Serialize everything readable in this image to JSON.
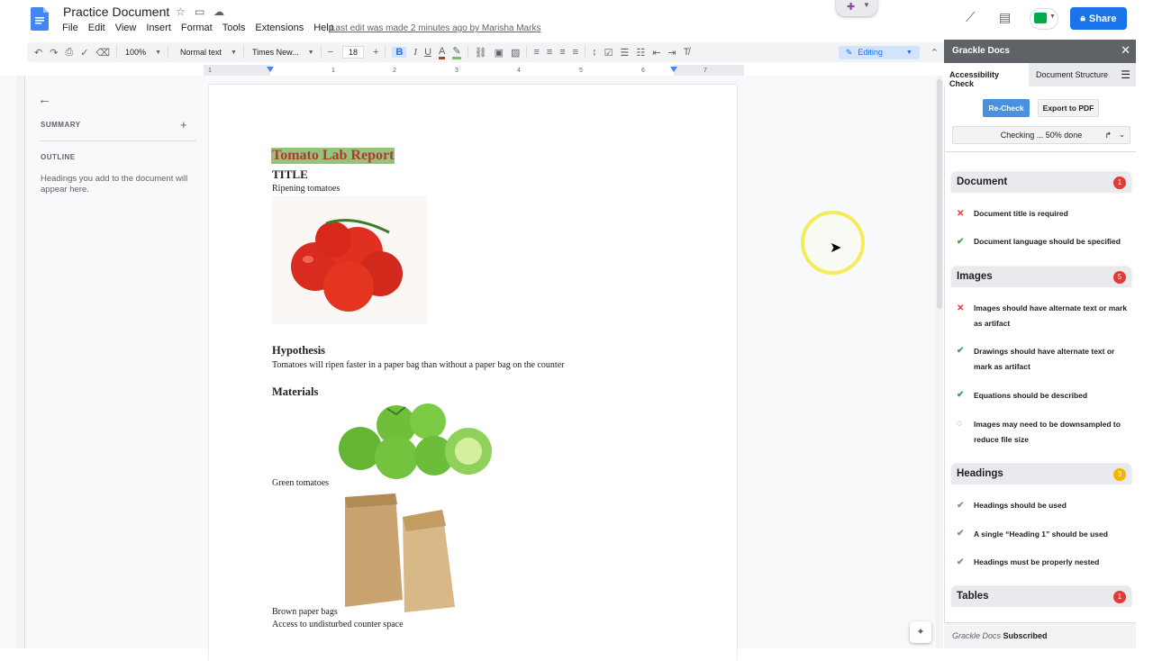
{
  "title": "Practice Document",
  "menu": [
    "File",
    "Edit",
    "View",
    "Insert",
    "Format",
    "Tools",
    "Extensions",
    "Help"
  ],
  "last_edit": "Last edit was made 2 minutes ago by Marisha Marks",
  "share_label": "Share",
  "toolbar": {
    "zoom": "100%",
    "style": "Normal text",
    "font": "Times New...",
    "font_size": "18",
    "mode": "Editing",
    "bold": "B",
    "italic": "I",
    "underline": "U",
    "text_color": "A"
  },
  "ruler_marks": [
    "1",
    "1",
    "2",
    "3",
    "4",
    "5",
    "6",
    "7"
  ],
  "outline": {
    "summary": "SUMMARY",
    "outline": "OUTLINE",
    "hint": "Headings you add to the document will appear here."
  },
  "doc": {
    "heading": "Tomato Lab Report",
    "title": "TITLE",
    "subtitle": "Ripening tomatoes",
    "hypothesis_h": "Hypothesis",
    "hypothesis": "Tomatoes will ripen faster in a paper bag than without a paper bag on the counter",
    "materials_h": "Materials",
    "m1": "Green tomatoes",
    "m2": "Brown paper bags",
    "m3": "Access to undisturbed counter space"
  },
  "sidebar": {
    "header": "Grackle Docs",
    "tab1": "Accessibility Check",
    "tab2": "Document Structure",
    "recheck": "Re-Check",
    "export": "Export to PDF",
    "status": "Checking ... 50% done",
    "footer_brand": "Grackle Docs",
    "footer_status": "Subscribed",
    "sections": [
      {
        "name": "Document",
        "count": "1",
        "color": "#e53935"
      },
      {
        "name": "Images",
        "count": "5",
        "color": "#e53935"
      },
      {
        "name": "Headings",
        "count": "3",
        "color": "#f4b400"
      },
      {
        "name": "Tables",
        "count": "1",
        "color": "#e53935"
      }
    ],
    "checks": {
      "doc1": "Document title is required",
      "doc2": "Document language should be specified",
      "img1": "Images should have alternate text or mark as artifact",
      "img2": "Drawings should have alternate text or mark as artifact",
      "img3": "Equations should be described",
      "img4": "Images may need to be downsampled to reduce file size",
      "h1": "Headings should be used",
      "h2": "A single “Heading 1” should be used",
      "h3": "Headings must be properly nested"
    }
  }
}
